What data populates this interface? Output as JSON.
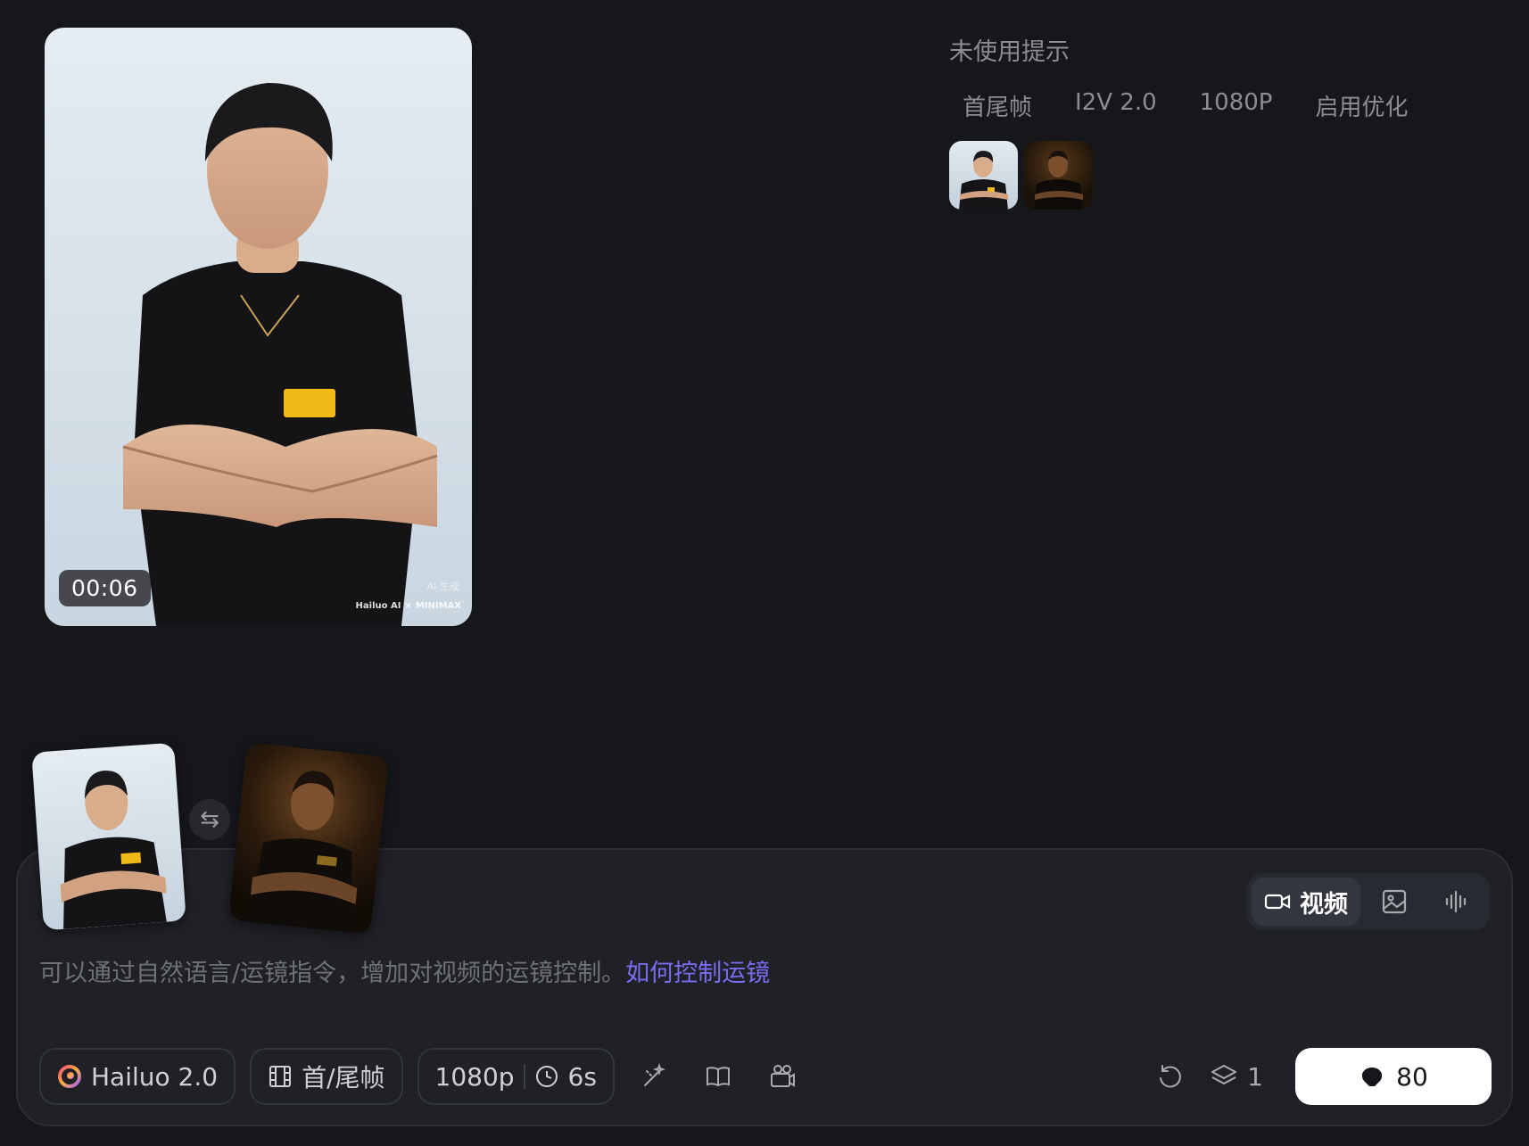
{
  "video": {
    "duration": "00:06",
    "ai_tag": "AI 生成",
    "watermark_brand": "Hailuo AI",
    "watermark_partner": "MINIMAX"
  },
  "prompt_info": {
    "title": "未使用提示",
    "tags": [
      "首尾帧",
      "I2V 2.0",
      "1080P",
      "启用优化"
    ]
  },
  "swap_icon": "⇆",
  "composer": {
    "modes": {
      "video_label": "视频",
      "video_icon": "video-camera-icon",
      "image_icon": "image-icon",
      "audio_icon": "audio-wave-icon"
    },
    "placeholder_text": "可以通过自然语言/运镜指令，增加对视频的运镜控制。",
    "help_link": "如何控制运镜",
    "model_label": "Hailuo 2.0",
    "frame_mode_label": "首/尾帧",
    "resolution_label": "1080p",
    "duration_label": "6s",
    "count_value": "1",
    "credits_value": "80"
  },
  "colors": {
    "background": "#16171b",
    "composer_bg": "#1f2126",
    "link": "#7b6cf0",
    "generate_button": "#ffffff"
  }
}
